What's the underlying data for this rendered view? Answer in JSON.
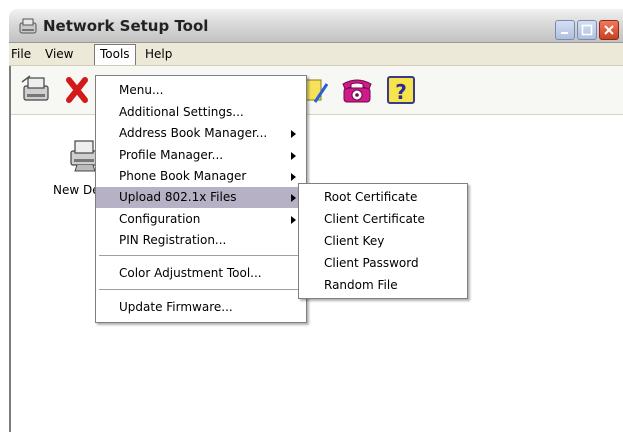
{
  "window": {
    "title": "Network Setup Tool"
  },
  "menubar": {
    "items": [
      "File",
      "View",
      "Tools",
      "Help"
    ],
    "active": "Tools"
  },
  "toolbar": {
    "icons": [
      "new-device-icon",
      "delete-icon",
      "note-icon",
      "phone-icon",
      "help-icon"
    ]
  },
  "main": {
    "device_label": "New Device"
  },
  "tools_menu": {
    "items": [
      "Menu...",
      "Additional Settings...",
      "Address Book Manager...",
      "Profile Manager...",
      "Phone Book Manager",
      "Upload 802.1x Files",
      "Configuration",
      "PIN Registration...",
      "Color Adjustment Tool...",
      "Update Firmware..."
    ],
    "highlighted": "Upload 802.1x Files"
  },
  "submenu": {
    "items": [
      "Root Certificate",
      "Client Certificate",
      "Client Key",
      "Client Password",
      "Random File"
    ]
  },
  "colors": {
    "menu_highlight": "#b6b1c4",
    "close_button": "#c8401f",
    "phone": "#d01a8c"
  }
}
